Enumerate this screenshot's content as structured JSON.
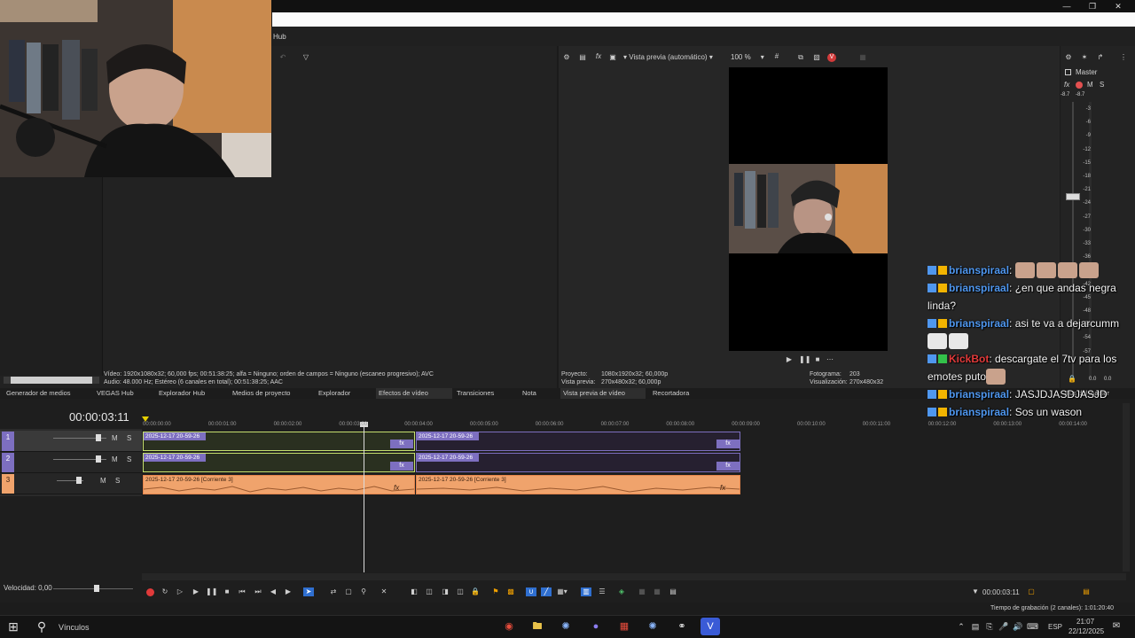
{
  "window": {
    "menu_hub": "Hub"
  },
  "left_pane": {
    "media_info_line1": "Vídeo: 1920x1080x32; 60,000 fps; 00:51:38:25; alfa = Ninguno; orden de campos = Ninguno (escaneo progresivo); AVC",
    "media_info_line2": "Audio: 48.000 Hz; Estéreo (6 canales en total); 00:51:38:25; AAC"
  },
  "preview": {
    "toolbar_mode": "Vista previa (automático)",
    "zoom": "100 %",
    "project_label": "Proyecto:",
    "project_value": "1080x1920x32; 60,000p",
    "preview_label": "Vista previa:",
    "preview_value": "270x480x32; 60,000p",
    "frame_label": "Fotograma:",
    "frame_value": "203",
    "display_label": "Visualización:",
    "display_value": "270x480x32"
  },
  "mixer": {
    "title": "Master",
    "fx": "fx",
    "m": "M",
    "s": "S",
    "peak_l": "-8.7",
    "peak_r": "-8.7",
    "scale": [
      "3",
      "6",
      "9",
      "12",
      "15",
      "18",
      "21",
      "24",
      "27",
      "30",
      "33",
      "36",
      "39",
      "42",
      "45",
      "48",
      "51",
      "54",
      "57"
    ],
    "bottom_l": "0.0",
    "bottom_r": "0.0",
    "tab": "Bus del master"
  },
  "tabs": [
    {
      "label": "Generador de medios"
    },
    {
      "label": "VEGAS Hub"
    },
    {
      "label": "Explorador Hub"
    },
    {
      "label": "Medios de proyecto"
    },
    {
      "label": "Explorador"
    },
    {
      "label": "Efectos de vídeo"
    },
    {
      "label": "Transiciones"
    },
    {
      "label": "Nota"
    },
    {
      "label": "Vista previa de vídeo"
    },
    {
      "label": "Recortadora"
    }
  ],
  "timeline": {
    "timecode": "00:00:03:11",
    "ruler": [
      "00:00:00:00",
      "00:00:01:00",
      "00:00:02:00",
      "00:00:03:00",
      "00:00:04:00",
      "00:00:05:00",
      "00:00:06:00",
      "00:00:07:00",
      "00:00:08:00",
      "00:00:09:00",
      "00:00:10:00",
      "00:00:11:00",
      "00:00:12:00",
      "00:00:13:00",
      "00:00:14:00"
    ],
    "tracks": [
      {
        "num": "1",
        "m": "M",
        "s": "S"
      },
      {
        "num": "2",
        "m": "M",
        "s": "S"
      },
      {
        "num": "3",
        "m": "M",
        "s": "S"
      }
    ],
    "clip_video_a": "2025-12-17 20-59-26",
    "clip_video_b": "2025-12-17 20-59-26",
    "clip_audio_a": "2025-12-17 20-59-26 [Corriente 3]",
    "clip_audio_b": "2025-12-17 20-59-26 [Corriente 3]",
    "fx_label": "fx"
  },
  "transport": {
    "speed": "Velocidad: 0,00",
    "cursor_time": "00:00:03:11"
  },
  "status": {
    "record_time": "Tiempo de grabación (2 canales): 1:01:20:40"
  },
  "taskbar": {
    "links": "Vínculos",
    "lang": "ESP",
    "time": "21:07",
    "date": "22/12/2025"
  },
  "chat": {
    "messages": [
      {
        "user": "brianspiraal",
        "text": "",
        "emotes": 4
      },
      {
        "user": "brianspiraal",
        "text": "¿en que andas negra linda?",
        "emotes": 0
      },
      {
        "user": "brianspiraal",
        "text": "asi te va a dejarcumm",
        "emotes": 2
      },
      {
        "user": "KickBot",
        "text": "descargate el 7tv para los emotes puto",
        "emotes": 1
      },
      {
        "user": "brianspiraal",
        "text": "JASJDJASDJASJD",
        "emotes": 0
      },
      {
        "user": "brianspiraal",
        "text": "Sos un wason",
        "emotes": 0
      }
    ]
  }
}
